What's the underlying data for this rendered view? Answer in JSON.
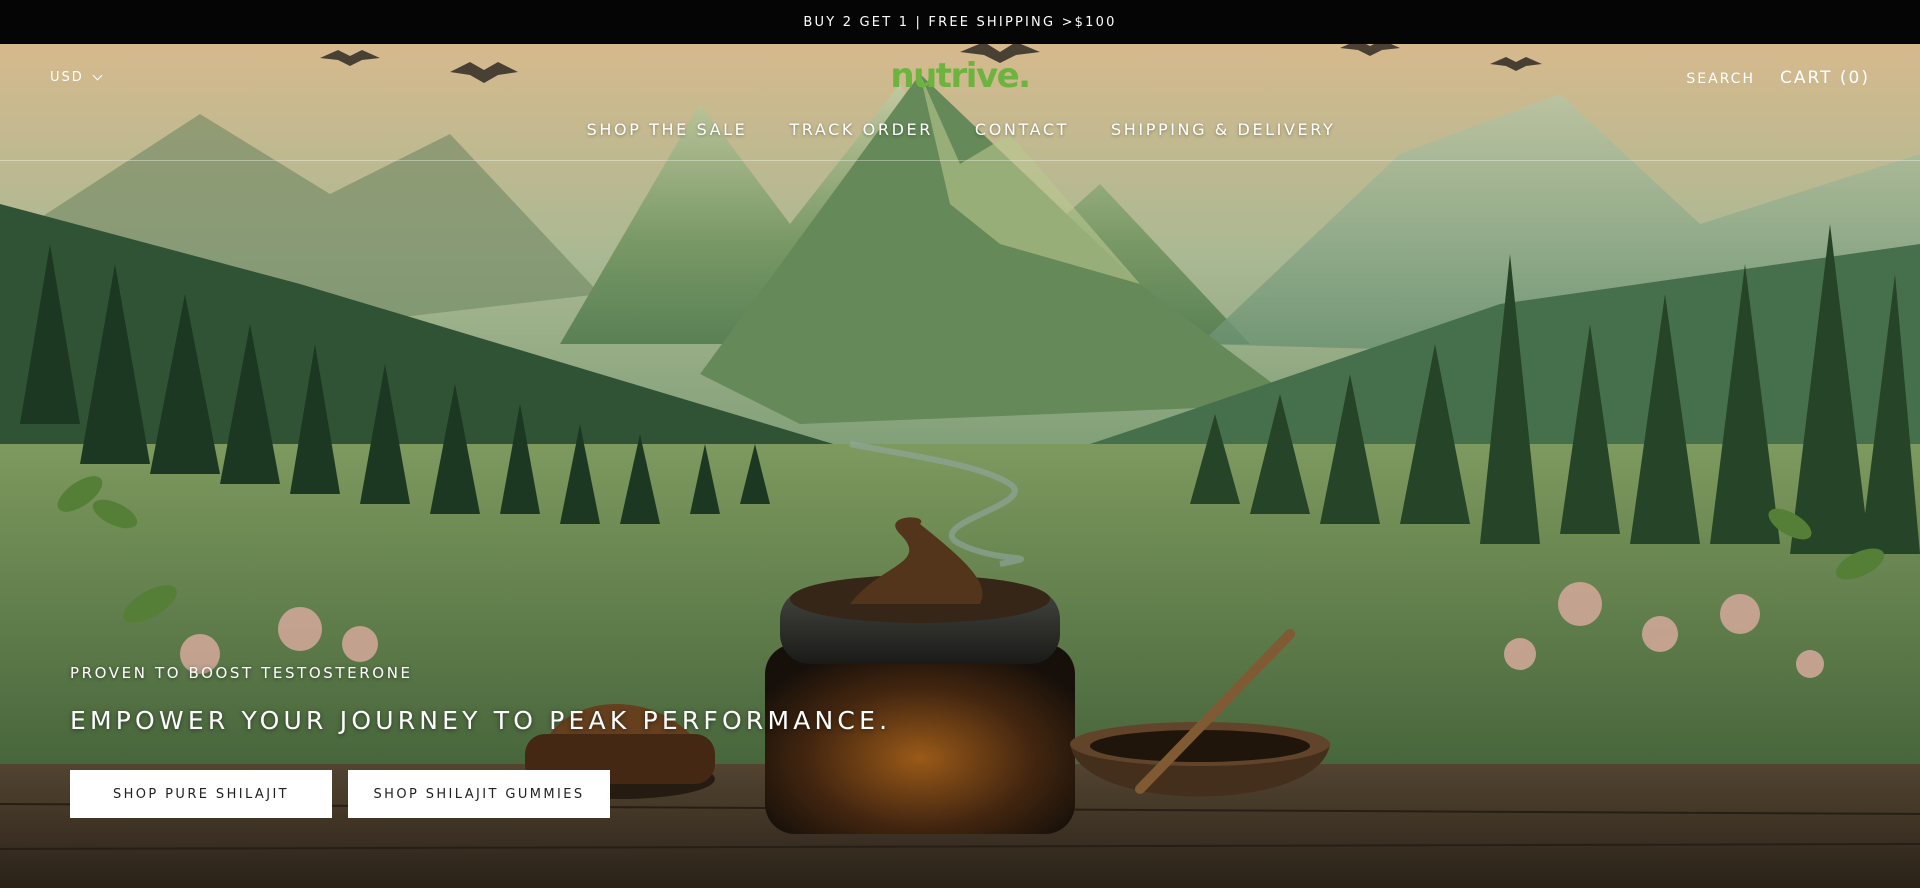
{
  "announcement": {
    "text": "BUY 2 GET 1 | FREE SHIPPING >$100"
  },
  "header": {
    "currency": "USD",
    "logo": "nutrive.",
    "search_label": "SEARCH",
    "cart_label": "CART (0)",
    "nav": [
      {
        "label": "SHOP THE SALE"
      },
      {
        "label": "TRACK ORDER"
      },
      {
        "label": "CONTACT"
      },
      {
        "label": "SHIPPING & DELIVERY"
      }
    ]
  },
  "hero": {
    "kicker": "PROVEN TO BOOST TESTOSTERONE",
    "headline": "EMPOWER YOUR JOURNEY TO PEAK PERFORMANCE.",
    "buttons": [
      {
        "label": "SHOP PURE SHILAJIT"
      },
      {
        "label": "SHOP SHILAJIT GUMMIES"
      }
    ]
  },
  "colors": {
    "brand_green": "#6cb33f",
    "announcement_bg": "#050505",
    "button_bg": "#ffffff"
  },
  "icons": [
    "chevron-down-icon"
  ]
}
